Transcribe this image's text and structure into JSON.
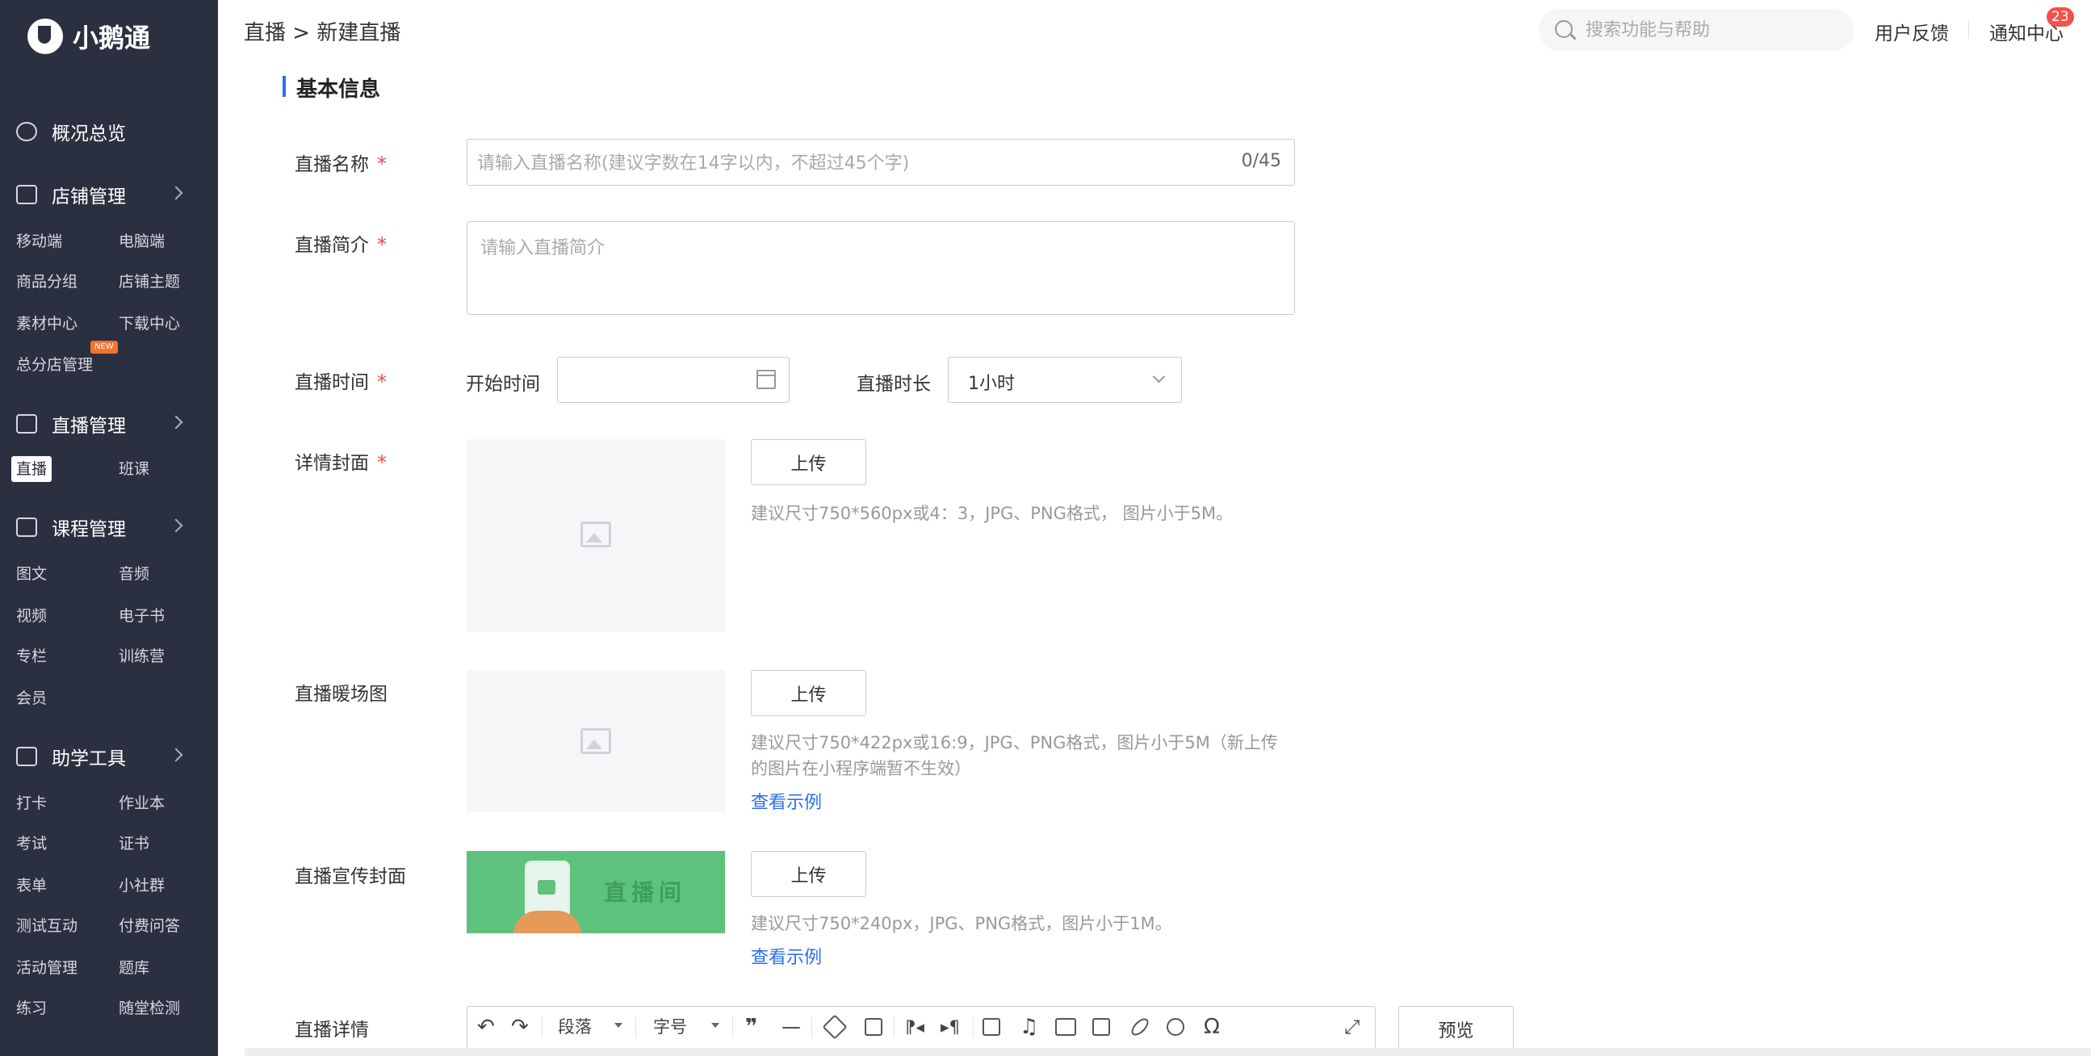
{
  "app": {
    "logo_text": "小鹅通"
  },
  "sidebar": {
    "groups": [
      {
        "label": "概况总览"
      },
      {
        "label": "店铺管理",
        "items": [
          "移动端",
          "电脑端",
          "商品分组",
          "店铺主题",
          "素材中心",
          "下载中心",
          "总分店管理"
        ],
        "badge": "NEW"
      },
      {
        "label": "直播管理",
        "items": [
          "直播",
          "班课"
        ]
      },
      {
        "label": "课程管理",
        "items": [
          "图文",
          "音频",
          "视频",
          "电子书",
          "专栏",
          "训练营",
          "会员"
        ]
      },
      {
        "label": "助学工具",
        "items": [
          "打卡",
          "作业本",
          "考试",
          "证书",
          "表单",
          "小社群",
          "测试互动",
          "付费问答",
          "活动管理",
          "题库",
          "练习",
          "随堂检测"
        ]
      }
    ],
    "active_item": "直播"
  },
  "header": {
    "breadcrumb": "直播 > 新建直播",
    "search_placeholder": "搜索功能与帮助",
    "feedback": "用户反馈",
    "notifications": "通知中心",
    "notification_count": "23"
  },
  "form": {
    "section_title": "基本信息",
    "required_mark": "*",
    "name": {
      "label": "直播名称",
      "placeholder": "请输入直播名称(建议字数在14字以内，不超过45个字)",
      "counter": "0/45"
    },
    "intro": {
      "label": "直播简介",
      "placeholder": "请输入直播简介"
    },
    "time": {
      "label": "直播时间",
      "start_label": "开始时间",
      "duration_label": "直播时长",
      "duration_value": "1小时"
    },
    "cover": {
      "label": "详情封面",
      "upload": "上传",
      "hint": "建议尺寸750*560px或4：3，JPG、PNG格式， 图片小于5M。"
    },
    "warmup": {
      "label": "直播暖场图",
      "upload": "上传",
      "hint": "建议尺寸750*422px或16:9，JPG、PNG格式，图片小于5M（新上传的图片在小程序端暂不生效）",
      "example": "查看示例"
    },
    "promo": {
      "label": "直播宣传封面",
      "upload": "上传",
      "hint": "建议尺寸750*240px，JPG、PNG格式，图片小于1M。",
      "example": "查看示例",
      "image_text": "直播间"
    },
    "detail": {
      "label": "直播详情",
      "paragraph": "段落",
      "font_size": "字号",
      "preview": "预览"
    }
  },
  "colors": {
    "sidebar_bg": "#2b3040",
    "accent": "#2a6ef0",
    "required": "#f04848",
    "badge": "#f5504a"
  },
  "icons": [
    "dashboard-icon",
    "store-icon",
    "live-icon",
    "course-icon",
    "toolbox-icon",
    "search-icon",
    "calendar-icon",
    "image-placeholder-icon"
  ]
}
